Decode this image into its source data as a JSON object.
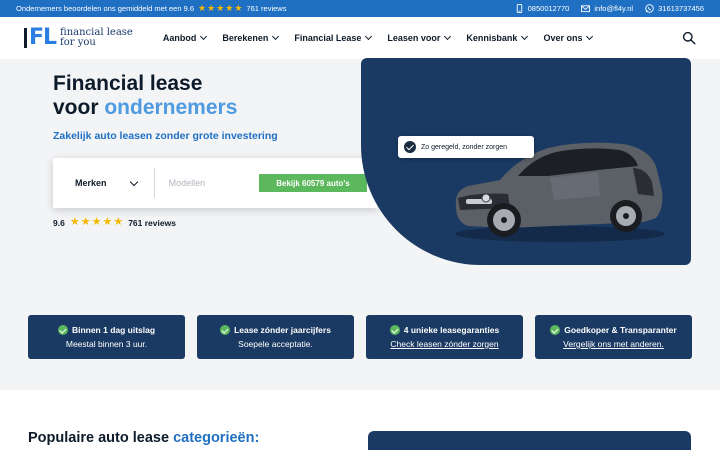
{
  "topbar": {
    "review_text": "Ondernemers beoordelen ons gemiddeld met een 9.6",
    "review_count": "761 reviews",
    "phone": "0850012770",
    "email": "info@fl4y.nl",
    "whatsapp": "31613737456"
  },
  "header": {
    "logo_mark": "FL",
    "logo_line1": "financial lease",
    "logo_line2": "for you",
    "nav": [
      "Aanbod",
      "Berekenen",
      "Financial Lease",
      "Leasen voor",
      "Kennisbank",
      "Over ons"
    ]
  },
  "hero": {
    "title_line1": "Financial lease",
    "title_line2_prefix": "voor ",
    "title_line2_accent": "ondernemers",
    "subtitle": "Zakelijk auto leasen zonder grote investering",
    "brand_select": "Merken",
    "model_placeholder": "Modellen",
    "cta": "Bekijk 60579 auto's",
    "rating_score": "9.6",
    "rating_count": "761 reviews",
    "tagline": "Zo geregeld, zonder zorgen"
  },
  "usps": [
    {
      "title": "Binnen 1 dag uitslag",
      "sub": "Meestal binnen 3 uur.",
      "link": false
    },
    {
      "title": "Lease zónder jaarcijfers",
      "sub": "Soepele acceptatie.",
      "link": false
    },
    {
      "title": "4 unieke leasegaranties",
      "sub": "Check leasen zónder zorgen",
      "link": true
    },
    {
      "title": "Goedkoper & Transparanter",
      "sub": "Vergelijk ons met anderen.",
      "link": true
    }
  ],
  "popular": {
    "title_prefix": "Populaire auto lease ",
    "title_accent": "categorieën:"
  },
  "colors": {
    "brand_blue": "#1f6fc2",
    "navy": "#1b3a63",
    "accent_green": "#5cb85c",
    "star": "#f5b800"
  },
  "icons": [
    "star-icon",
    "phone-icon",
    "mail-icon",
    "whatsapp-icon",
    "chevron-down-icon",
    "search-icon",
    "check-icon"
  ]
}
